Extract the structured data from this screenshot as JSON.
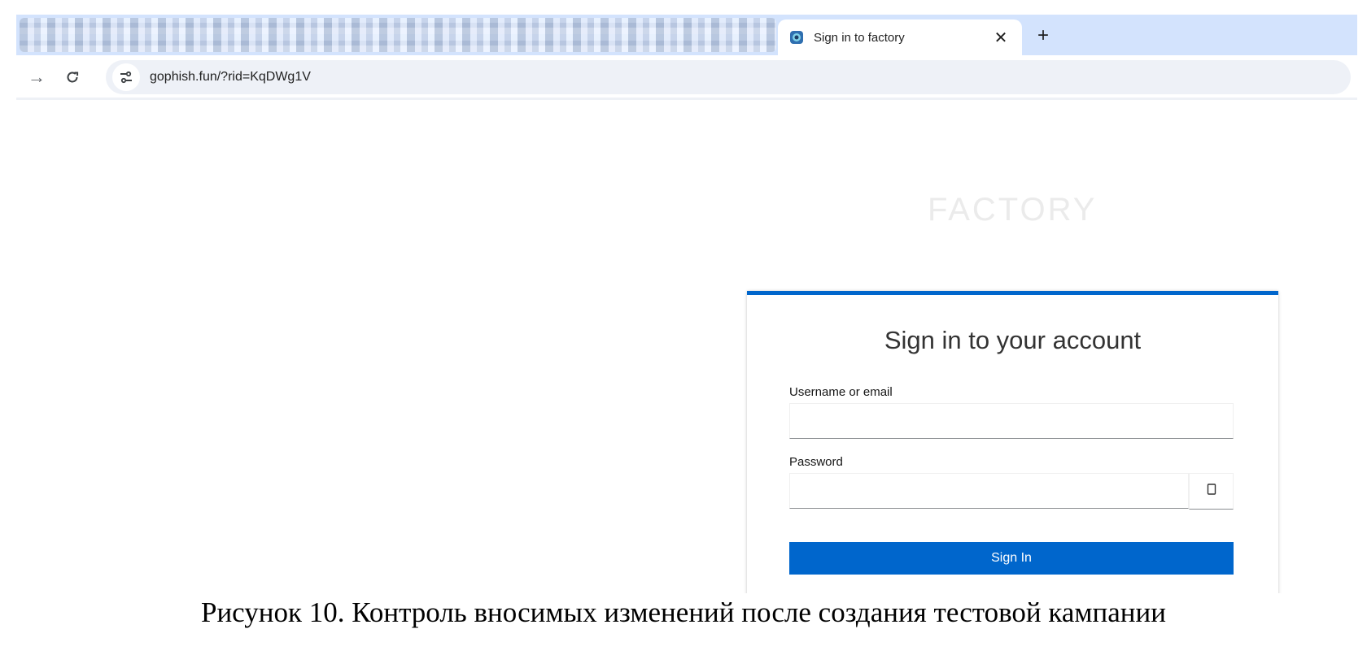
{
  "browser": {
    "tab": {
      "title": "Sign in to factory",
      "favicon": "site-favicon-icon",
      "close_glyph": "✕"
    },
    "new_tab_glyph": "+",
    "toolbar": {
      "forward_glyph": "→",
      "reload_glyph": "↻",
      "url": "gophish.fun/?rid=KqDWg1V"
    }
  },
  "page": {
    "brand": "FACTORY",
    "login": {
      "title": "Sign in to your account",
      "username_label": "Username or email",
      "username_value": "",
      "password_label": "Password",
      "password_value": "",
      "submit_label": "Sign In"
    }
  },
  "caption": "Рисунок 10. Контроль вносимых изменений после создания тестовой кампании",
  "colors": {
    "accent": "#0066cc",
    "tabstrip": "#d3e3fd",
    "brand_text": "#ebebeb"
  }
}
